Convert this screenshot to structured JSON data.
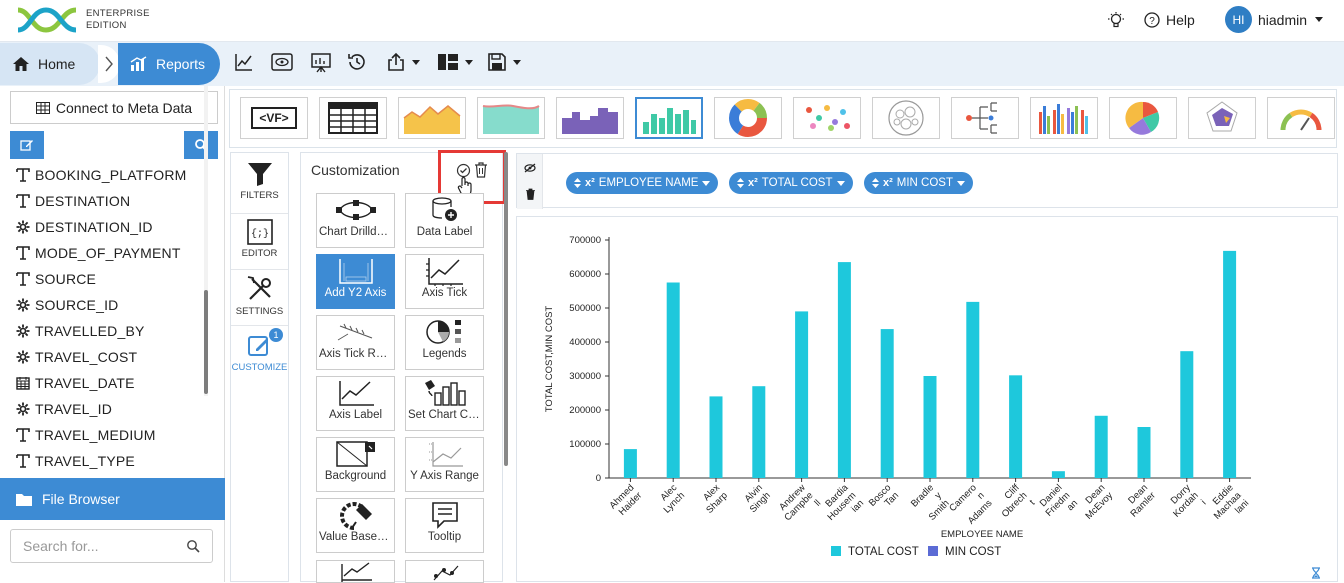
{
  "header": {
    "logo_text_line1": "ENTERPRISE",
    "logo_text_line2": "EDITION",
    "help_label": "Help",
    "avatar_initials": "HI",
    "username": "hiadmin"
  },
  "breadcrumb": {
    "home_label": "Home",
    "reports_label": "Reports"
  },
  "toolbar": {
    "icons": [
      "line-chart-icon",
      "preview-icon",
      "presentation-icon",
      "history-icon",
      "export-icon",
      "layout-icon",
      "save-icon"
    ]
  },
  "sidebar": {
    "connect_label": "Connect to Meta Data",
    "fields": [
      {
        "name": "BOOKING_PLATFORM",
        "type": "text"
      },
      {
        "name": "DESTINATION",
        "type": "text"
      },
      {
        "name": "DESTINATION_ID",
        "type": "number"
      },
      {
        "name": "MODE_OF_PAYMENT",
        "type": "text"
      },
      {
        "name": "SOURCE",
        "type": "text"
      },
      {
        "name": "SOURCE_ID",
        "type": "number"
      },
      {
        "name": "TRAVELLED_BY",
        "type": "number"
      },
      {
        "name": "TRAVEL_COST",
        "type": "number"
      },
      {
        "name": "TRAVEL_DATE",
        "type": "date"
      },
      {
        "name": "TRAVEL_ID",
        "type": "number"
      },
      {
        "name": "TRAVEL_MEDIUM",
        "type": "text"
      },
      {
        "name": "TRAVEL_TYPE",
        "type": "text"
      }
    ],
    "file_browser_label": "File Browser",
    "search_placeholder": "Search for..."
  },
  "chart_types": {
    "vf_label": "<VF>",
    "selected_index": 5
  },
  "tools": {
    "filters_label": "FILTERS",
    "editor_label": "EDITOR",
    "settings_label": "SETTINGS",
    "customize_label": "CUSTOMIZE",
    "customize_badge": "1"
  },
  "customization": {
    "title": "Customization",
    "cards": [
      {
        "label": "Chart Drilldown",
        "icon": "drilldown-icon"
      },
      {
        "label": "Data Label",
        "icon": "data-label-icon"
      },
      {
        "label": "Add Y2 Axis",
        "icon": "y2-axis-icon",
        "active": true
      },
      {
        "label": "Axis Tick",
        "icon": "axis-tick-icon"
      },
      {
        "label": "Axis Tick Rotation",
        "icon": "axis-tick-rotation-icon"
      },
      {
        "label": "Legends",
        "icon": "legends-icon"
      },
      {
        "label": "Axis Label",
        "icon": "axis-label-icon"
      },
      {
        "label": "Set Chart Color",
        "icon": "chart-color-icon"
      },
      {
        "label": "Background",
        "icon": "background-icon"
      },
      {
        "label": "Y Axis Range",
        "icon": "y-axis-range-icon"
      },
      {
        "label": "Value Based Color",
        "icon": "value-color-icon"
      },
      {
        "label": "Tooltip",
        "icon": "tooltip-icon"
      }
    ]
  },
  "fields_bar": {
    "pills": [
      "EMPLOYEE NAME",
      "TOTAL COST",
      "MIN COST"
    ],
    "pill_prefix": "x²"
  },
  "chart_data": {
    "type": "bar",
    "categories": [
      "Ahmed Haider",
      "Alec Lynch",
      "Alex Sharp",
      "Alvin Singh",
      "Andrew Campbell",
      "Bardia Housemian",
      "Bosco Tan",
      "Bradley Smith",
      "Cameron Adams",
      "Cliff Obrecht",
      "Daniel Friedman",
      "Dean McEvoy",
      "Dean Ramler",
      "Dorry Kordahi",
      "Eddie Machaalani"
    ],
    "category_lines": [
      [
        "Ahmed",
        "Haider"
      ],
      [
        "Alec",
        "Lynch"
      ],
      [
        "Alex",
        "Sharp"
      ],
      [
        "Alvin",
        "Singh"
      ],
      [
        "Andrew",
        "Campbe",
        "ll"
      ],
      [
        "Bardia",
        "Housem",
        "ian"
      ],
      [
        "Bosco",
        "Tan"
      ],
      [
        "Bradle",
        "y",
        "Smith"
      ],
      [
        "Camero",
        "n",
        "Adams"
      ],
      [
        "Cliff",
        "Obrech",
        "t"
      ],
      [
        "Daniel",
        "Friedm",
        "an"
      ],
      [
        "Dean",
        "McEvoy"
      ],
      [
        "Dean",
        "Ramler"
      ],
      [
        "Dorry",
        "Kordah",
        "i"
      ],
      [
        "Eddie",
        "Machaa",
        "lani"
      ]
    ],
    "series": [
      {
        "name": "TOTAL COST",
        "values": [
          85000,
          575000,
          240000,
          270000,
          490000,
          635000,
          438000,
          300000,
          518000,
          302000,
          20000,
          183000,
          150000,
          373000,
          668000
        ]
      },
      {
        "name": "MIN COST",
        "values": [
          0,
          0,
          0,
          0,
          0,
          0,
          0,
          0,
          0,
          0,
          0,
          0,
          0,
          0,
          0
        ]
      }
    ],
    "colors": {
      "TOTAL COST": "#1ec8dc",
      "MIN COST": "#5b6bd5"
    },
    "xlabel": "EMPLOYEE NAME",
    "ylabel": "TOTAL COST,MIN COST",
    "ylim": [
      0,
      700000
    ],
    "yticks": [
      "0",
      "100000",
      "200000",
      "300000",
      "400000",
      "500000",
      "600000",
      "700000"
    ],
    "grid": false,
    "legend_position": "bottom-center"
  }
}
